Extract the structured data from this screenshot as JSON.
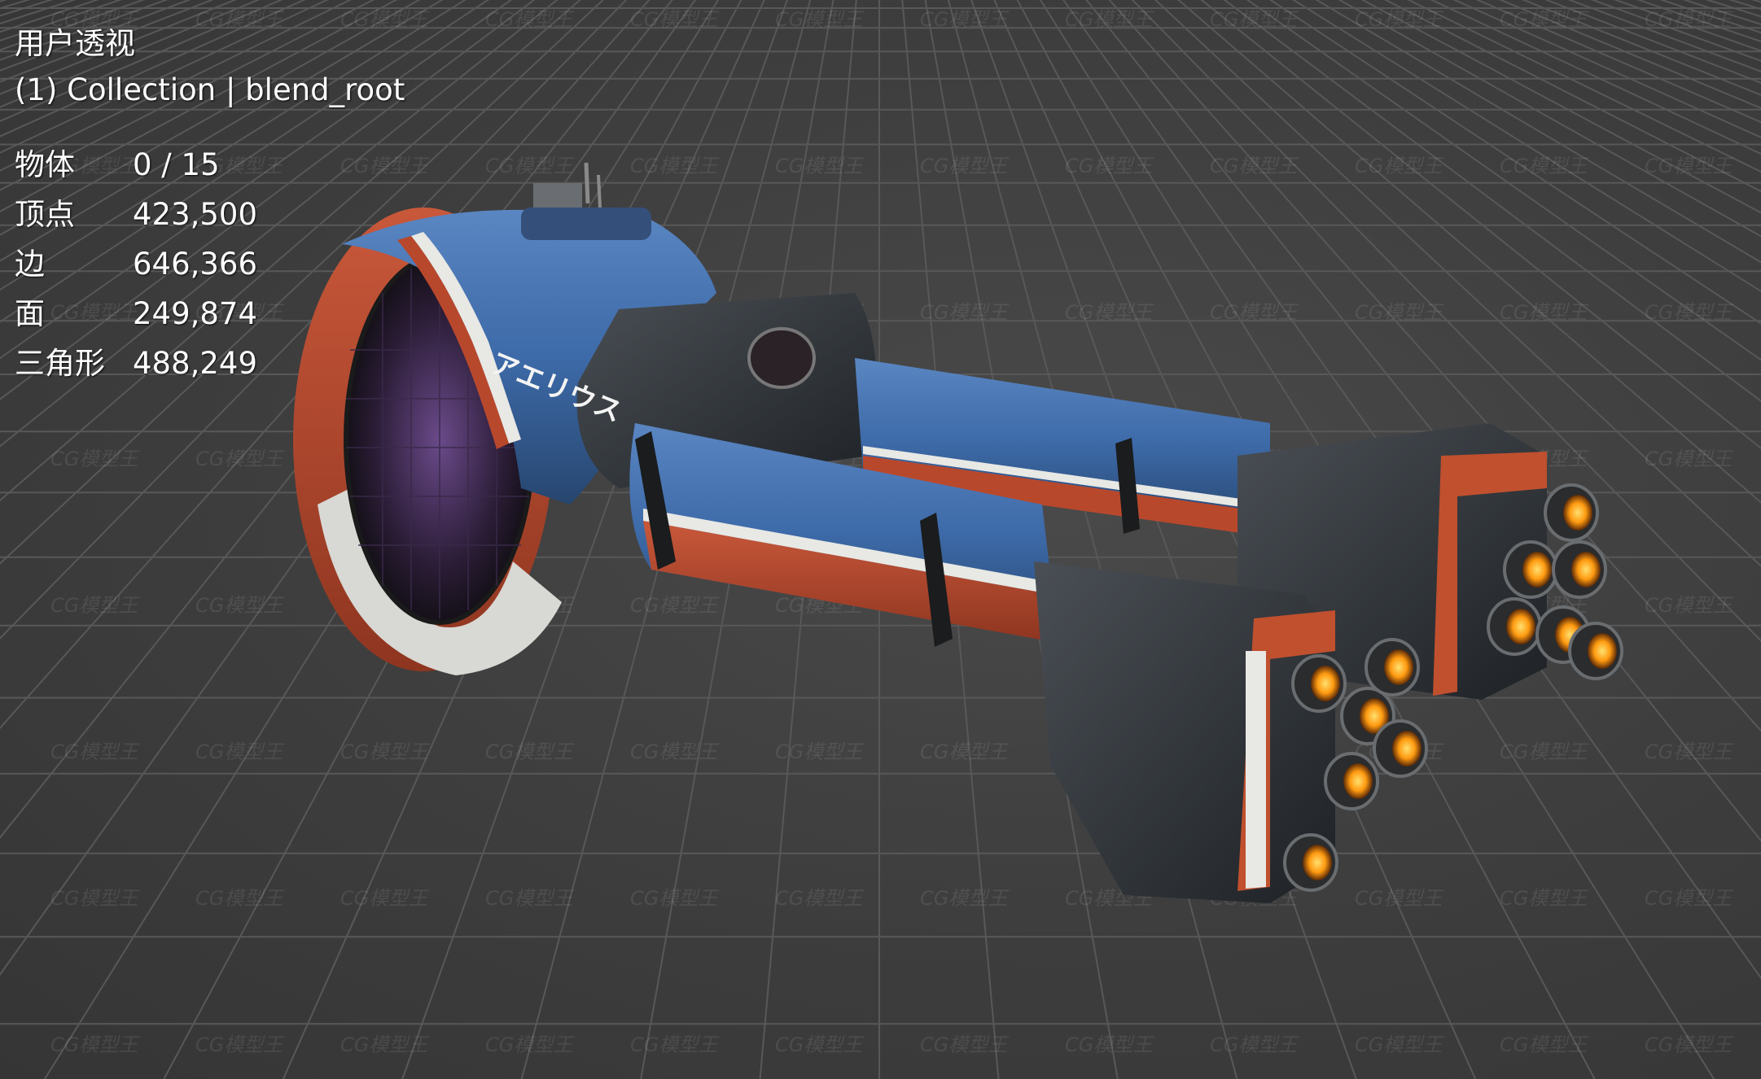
{
  "viewport": {
    "view_name": "用户透视",
    "collection": "(1) Collection | blend_root",
    "stats": [
      {
        "label": "物体",
        "value": "0 / 15"
      },
      {
        "label": "顶点",
        "value": "423,500"
      },
      {
        "label": "边",
        "value": "646,366"
      },
      {
        "label": "面",
        "value": "249,874"
      },
      {
        "label": "三角形",
        "value": "488,249"
      }
    ],
    "watermark": "CG模型王",
    "colors": {
      "background": "#3b3b3b",
      "grid": "#555555",
      "hull_blue": "#3d6aa8",
      "hull_red": "#b8482c",
      "hull_white": "#d8d8d4",
      "engine_glow": "#ffb020"
    },
    "model_text": "アエリウス"
  }
}
